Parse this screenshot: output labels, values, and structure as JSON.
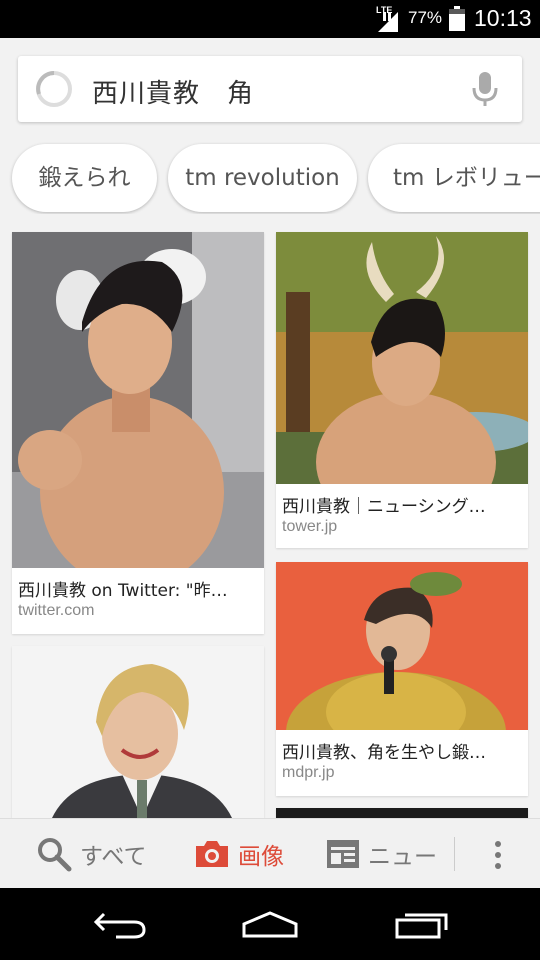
{
  "status_bar": {
    "network": "LTE",
    "battery_percent": "77%",
    "time": "10:13"
  },
  "search": {
    "query": "西川貴教　角",
    "mic_icon": "microphone-icon",
    "loading_icon": "spinner-icon"
  },
  "chips": [
    {
      "label": "鍛えられ"
    },
    {
      "label": "tm revolution"
    },
    {
      "label": "tm レボリュー"
    }
  ],
  "results": [
    {
      "title": "西川貴教 on Twitter: \"昨…",
      "domain": "twitter.com"
    },
    {
      "title": "西川貴教｜ニューシング…",
      "domain": "tower.jp"
    },
    {
      "title": "西川貴教、角を生やし鍛…",
      "domain": "mdpr.jp"
    },
    {
      "title": "",
      "domain": ""
    }
  ],
  "toolbar": {
    "all_label": "すべて",
    "images_label": "画像",
    "news_label": "ニュー",
    "active_color": "#dd4b39"
  },
  "nav": {
    "back_icon": "back-icon",
    "home_icon": "home-icon",
    "recents_icon": "recents-icon"
  }
}
